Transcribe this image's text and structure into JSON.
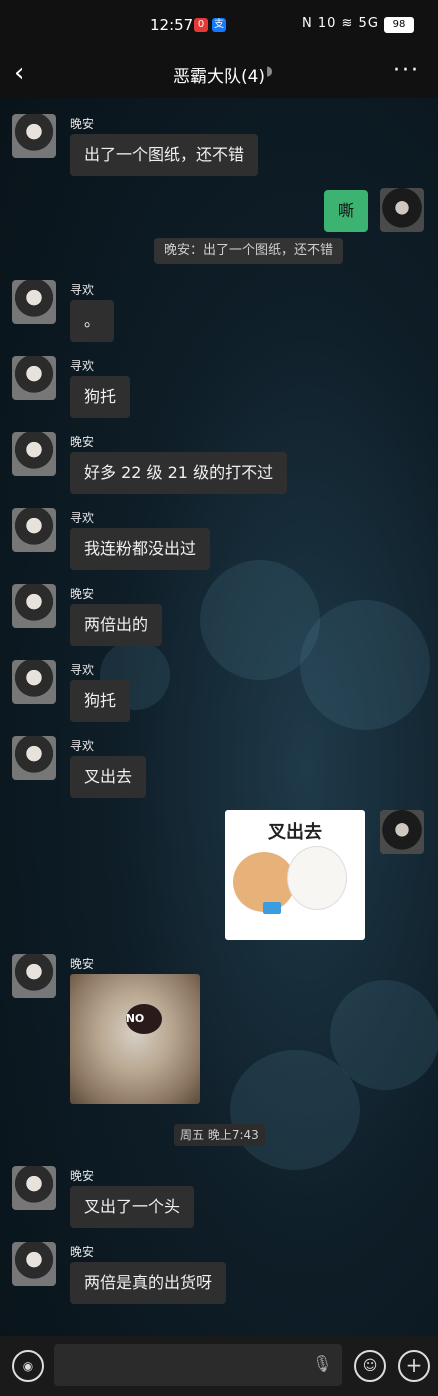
{
  "status": {
    "time": "12:57",
    "badge1": "0",
    "badge2": "支",
    "icons": "N 10 ≋ 5G",
    "battery": "98"
  },
  "header": {
    "title": "恶霸大队(4)",
    "back": "‹",
    "more": "···",
    "ear_icon": "ear-icon"
  },
  "messages": [
    {
      "sender": "晚安",
      "text": "出了一个图纸，还不错"
    },
    {
      "sender": "me",
      "text": "嘶",
      "quote": "晚安：出了一个图纸，还不错"
    },
    {
      "sender": "寻欢",
      "text": "。"
    },
    {
      "sender": "寻欢",
      "text": "狗托"
    },
    {
      "sender": "晚安",
      "text": "好多 22 级 21 级的打不过"
    },
    {
      "sender": "寻欢",
      "text": "我连粉都没出过"
    },
    {
      "sender": "晚安",
      "text": "两倍出的"
    },
    {
      "sender": "寻欢",
      "text": "狗托"
    },
    {
      "sender": "寻欢",
      "text": "叉出去"
    },
    {
      "sender": "me",
      "sticker_text": "叉出去"
    },
    {
      "sender": "晚安",
      "image_text": "NO"
    },
    {
      "timestamp": "周五 晚上7:43"
    },
    {
      "sender": "晚安",
      "text": "叉出了一个头"
    },
    {
      "sender": "晚安",
      "text": "两倍是真的出货呀"
    }
  ],
  "input": {
    "placeholder": ""
  }
}
